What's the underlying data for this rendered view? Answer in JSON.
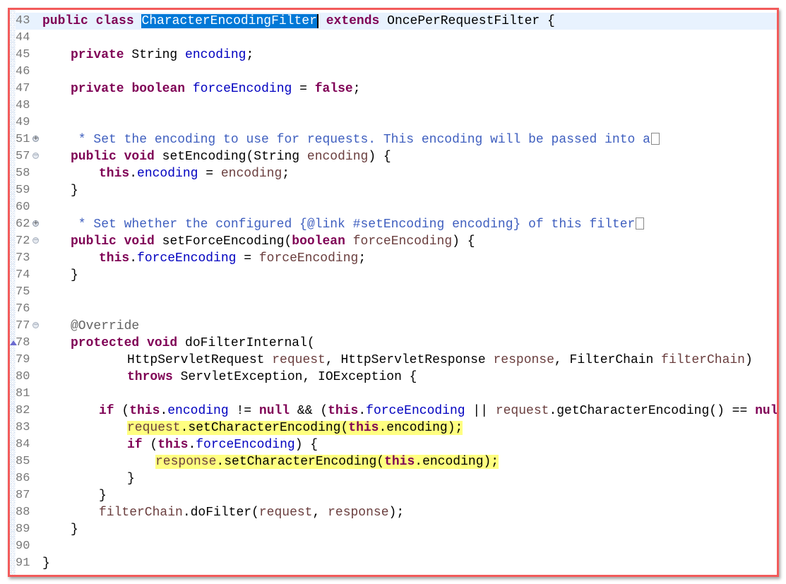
{
  "colors": {
    "keyword": "#7f0055",
    "field": "#0000c0",
    "parameter": "#6a3e3e",
    "javadoc": "#3f5fbf",
    "annotation": "#646464",
    "selection": "#0078d7",
    "highlight": "#ffff80",
    "frame": "#f25b5b"
  },
  "lines": [
    {
      "n": "43",
      "indent": 0,
      "current": true,
      "tokens": [
        [
          "public",
          "k"
        ],
        [
          " ",
          "t"
        ],
        [
          "class",
          "k"
        ],
        [
          " ",
          "t"
        ],
        [
          "CharacterEncodingFilter",
          "sel"
        ],
        [
          " ",
          "t"
        ],
        [
          "extends",
          "k"
        ],
        [
          " OncePerRequestFilter {",
          "t"
        ]
      ]
    },
    {
      "n": "44",
      "indent": 0,
      "tokens": []
    },
    {
      "n": "45",
      "indent": 1,
      "tokens": [
        [
          "private",
          "k"
        ],
        [
          " String ",
          "t"
        ],
        [
          "encoding",
          "f"
        ],
        [
          ";",
          "t"
        ]
      ]
    },
    {
      "n": "46",
      "indent": 0,
      "tokens": []
    },
    {
      "n": "47",
      "indent": 1,
      "tokens": [
        [
          "private",
          "k"
        ],
        [
          " ",
          "t"
        ],
        [
          "boolean",
          "k"
        ],
        [
          " ",
          "t"
        ],
        [
          "forceEncoding",
          "f"
        ],
        [
          " = ",
          "t"
        ],
        [
          "false",
          "k"
        ],
        [
          ";",
          "t"
        ]
      ]
    },
    {
      "n": "48",
      "indent": 0,
      "tokens": []
    },
    {
      "n": "49",
      "indent": 0,
      "tokens": []
    },
    {
      "n": "51",
      "indent": 1,
      "fold": "plus",
      "collapsed": true,
      "tokens": [
        [
          " * Set the encoding to use for requests. This encoding will be passed into a",
          "c"
        ]
      ]
    },
    {
      "n": "57",
      "indent": 1,
      "fold": "minus",
      "tokens": [
        [
          "public",
          "k"
        ],
        [
          " ",
          "t"
        ],
        [
          "void",
          "k"
        ],
        [
          " setEncoding(String ",
          "t"
        ],
        [
          "encoding",
          "p"
        ],
        [
          ") {",
          "t"
        ]
      ]
    },
    {
      "n": "58",
      "indent": 2,
      "tokens": [
        [
          "this",
          "k"
        ],
        [
          ".",
          "t"
        ],
        [
          "encoding",
          "f"
        ],
        [
          " = ",
          "t"
        ],
        [
          "encoding",
          "p"
        ],
        [
          ";",
          "t"
        ]
      ]
    },
    {
      "n": "59",
      "indent": 1,
      "tokens": [
        [
          "}",
          "t"
        ]
      ]
    },
    {
      "n": "60",
      "indent": 0,
      "tokens": []
    },
    {
      "n": "62",
      "indent": 1,
      "fold": "plus",
      "collapsed": true,
      "tokens": [
        [
          " * Set whether the configured {@link #setEncoding encoding} of this filter",
          "c"
        ]
      ]
    },
    {
      "n": "72",
      "indent": 1,
      "fold": "minus",
      "tokens": [
        [
          "public",
          "k"
        ],
        [
          " ",
          "t"
        ],
        [
          "void",
          "k"
        ],
        [
          " setForceEncoding(",
          "t"
        ],
        [
          "boolean",
          "k"
        ],
        [
          " ",
          "t"
        ],
        [
          "forceEncoding",
          "p"
        ],
        [
          ") {",
          "t"
        ]
      ]
    },
    {
      "n": "73",
      "indent": 2,
      "tokens": [
        [
          "this",
          "k"
        ],
        [
          ".",
          "t"
        ],
        [
          "forceEncoding",
          "f"
        ],
        [
          " = ",
          "t"
        ],
        [
          "forceEncoding",
          "p"
        ],
        [
          ";",
          "t"
        ]
      ]
    },
    {
      "n": "74",
      "indent": 1,
      "tokens": [
        [
          "}",
          "t"
        ]
      ]
    },
    {
      "n": "75",
      "indent": 0,
      "tokens": []
    },
    {
      "n": "76",
      "indent": 0,
      "tokens": []
    },
    {
      "n": "77",
      "indent": 1,
      "fold": "minus",
      "tokens": [
        [
          "@Override",
          "a"
        ]
      ]
    },
    {
      "n": "78",
      "indent": 1,
      "override": true,
      "tokens": [
        [
          "protected",
          "k"
        ],
        [
          " ",
          "t"
        ],
        [
          "void",
          "k"
        ],
        [
          " doFilterInternal(",
          "t"
        ]
      ]
    },
    {
      "n": "79",
      "indent": 3,
      "tokens": [
        [
          "HttpServletRequest ",
          "t"
        ],
        [
          "request",
          "p"
        ],
        [
          ", HttpServletResponse ",
          "t"
        ],
        [
          "response",
          "p"
        ],
        [
          ", FilterChain ",
          "t"
        ],
        [
          "filterChain",
          "p"
        ],
        [
          ")",
          "t"
        ]
      ]
    },
    {
      "n": "80",
      "indent": 3,
      "tokens": [
        [
          "throws",
          "k"
        ],
        [
          " ServletException, IOException {",
          "t"
        ]
      ]
    },
    {
      "n": "81",
      "indent": 0,
      "tokens": []
    },
    {
      "n": "82",
      "indent": 2,
      "tokens": [
        [
          "if",
          "k"
        ],
        [
          " (",
          "t"
        ],
        [
          "this",
          "k"
        ],
        [
          ".",
          "t"
        ],
        [
          "encoding",
          "f"
        ],
        [
          " != ",
          "t"
        ],
        [
          "null",
          "k"
        ],
        [
          " && (",
          "t"
        ],
        [
          "this",
          "k"
        ],
        [
          ".",
          "t"
        ],
        [
          "forceEncoding",
          "f"
        ],
        [
          " || ",
          "t"
        ],
        [
          "request",
          "p"
        ],
        [
          ".getCharacterEncoding() == ",
          "t"
        ],
        [
          "null",
          "k"
        ],
        [
          ")) {",
          "t"
        ]
      ]
    },
    {
      "n": "83",
      "indent": 3,
      "highlight": true,
      "tokens": [
        [
          "request",
          "p"
        ],
        [
          ".setCharacterEncoding(",
          "t"
        ],
        [
          "this",
          "k"
        ],
        [
          ".encoding);",
          "t"
        ]
      ]
    },
    {
      "n": "84",
      "indent": 3,
      "tokens": [
        [
          "if",
          "k"
        ],
        [
          " (",
          "t"
        ],
        [
          "this",
          "k"
        ],
        [
          ".",
          "t"
        ],
        [
          "forceEncoding",
          "f"
        ],
        [
          ") {",
          "t"
        ]
      ]
    },
    {
      "n": "85",
      "indent": 4,
      "highlight": true,
      "tokens": [
        [
          "response",
          "p"
        ],
        [
          ".setCharacterEncoding(",
          "t"
        ],
        [
          "this",
          "k"
        ],
        [
          ".encoding);",
          "t"
        ]
      ]
    },
    {
      "n": "86",
      "indent": 3,
      "tokens": [
        [
          "}",
          "t"
        ]
      ]
    },
    {
      "n": "87",
      "indent": 2,
      "tokens": [
        [
          "}",
          "t"
        ]
      ]
    },
    {
      "n": "88",
      "indent": 2,
      "tokens": [
        [
          "filterChain",
          "p"
        ],
        [
          ".doFilter(",
          "t"
        ],
        [
          "request",
          "p"
        ],
        [
          ", ",
          "t"
        ],
        [
          "response",
          "p"
        ],
        [
          ");",
          "t"
        ]
      ]
    },
    {
      "n": "89",
      "indent": 1,
      "tokens": [
        [
          "}",
          "t"
        ]
      ]
    },
    {
      "n": "90",
      "indent": 0,
      "tokens": []
    },
    {
      "n": "91",
      "indent": 0,
      "tokens": [
        [
          "}",
          "t"
        ]
      ]
    }
  ]
}
